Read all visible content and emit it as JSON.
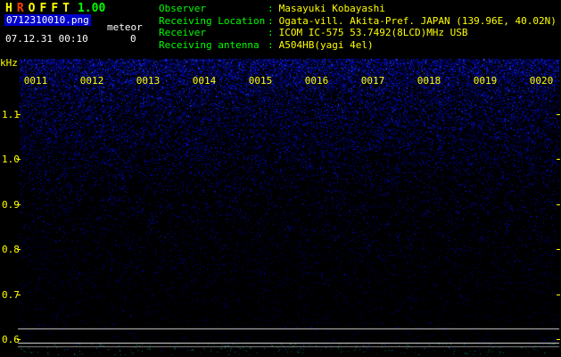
{
  "app": {
    "logo": {
      "letters": [
        "H",
        "R",
        "O",
        "F",
        "F",
        "T"
      ],
      "letter_colors": [
        "#ffff00",
        "#ff4000",
        "#ffff00",
        "#ffff00",
        "#ffff00",
        "#ffff00"
      ],
      "version": "1.00"
    },
    "filename": "0712310010.png",
    "mode": "meteor",
    "count": "0",
    "timestamp": "07.12.31 00:10"
  },
  "info": {
    "colon": ":",
    "rows": [
      {
        "label": "Observer",
        "value": "Masayuki Kobayashi"
      },
      {
        "label": "Receiving Location",
        "value": "Ogata-vill. Akita-Pref. JAPAN (139.96E, 40.02N)"
      },
      {
        "label": "Receiver",
        "value": "ICOM IC-575 53.7492(8LCD)MHz USB"
      },
      {
        "label": "Receiving antenna",
        "value": "A504HB(yagi 4el)"
      }
    ]
  },
  "spectrogram": {
    "y_axis": {
      "unit": "kHz",
      "ticks": [
        "1.1",
        "1.0",
        "0.9",
        "0.8",
        "0.7",
        "0.6"
      ]
    },
    "x_axis": {
      "ticks": [
        "0011",
        "0012",
        "0013",
        "0014",
        "0015",
        "0016",
        "0017",
        "0018",
        "0019",
        "0020"
      ]
    },
    "colors": {
      "axis_label": "#ffff00",
      "info_label": "#00ff00",
      "info_value": "#ffff00",
      "filename_bg": "#0000cc",
      "background": "#000000",
      "noise_palette": [
        "#000060",
        "#0000a0",
        "#0010d0",
        "#1838f0",
        "#3860ff"
      ]
    }
  }
}
